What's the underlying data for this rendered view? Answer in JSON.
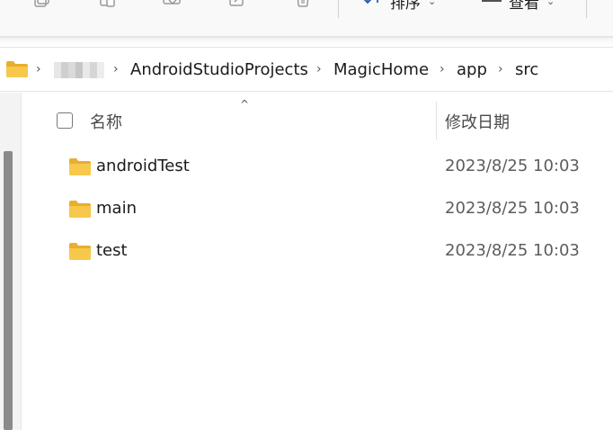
{
  "toolbar": {
    "icons": [
      "copy-icon",
      "paste-icon",
      "share-icon",
      "rename-icon",
      "delete-icon"
    ],
    "sort_label": "排序",
    "view_label": "查看"
  },
  "breadcrumb": {
    "root_icon": "folder-icon",
    "items": [
      "AndroidStudioProjects",
      "MagicHome",
      "app",
      "src"
    ]
  },
  "columns": {
    "name": "名称",
    "date_modified": "修改日期"
  },
  "files": [
    {
      "name": "androidTest",
      "modified": "2023/8/25 10:03",
      "type": "folder"
    },
    {
      "name": "main",
      "modified": "2023/8/25 10:03",
      "type": "folder"
    },
    {
      "name": "test",
      "modified": "2023/8/25 10:03",
      "type": "folder"
    }
  ],
  "colors": {
    "folder": "#f7c84b",
    "folder_dark": "#e8ae2c",
    "text_secondary": "#5d5d5d"
  }
}
